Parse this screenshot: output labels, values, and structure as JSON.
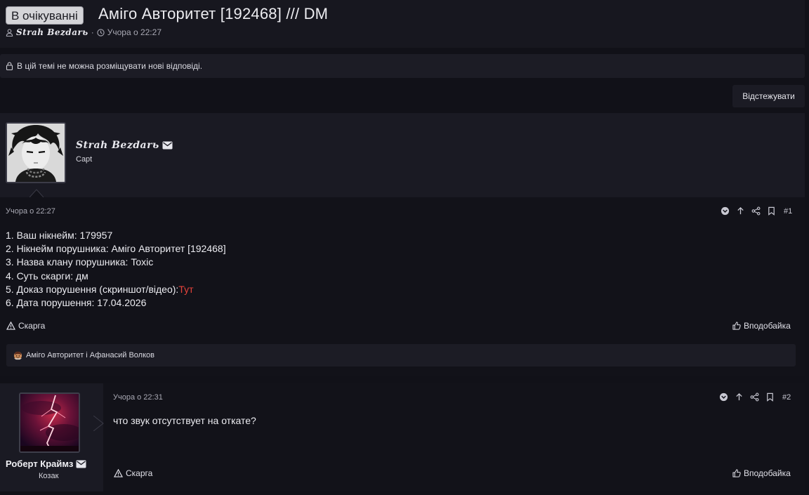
{
  "thread": {
    "prefix": "В очікуванні",
    "title": "Аміго Авторитет [192468] /// DM",
    "author": "Strah Bezdarь",
    "separator": "·",
    "date": "Учора о 22:27",
    "locked_notice": "В цій темі не можна розміщувати нові відповіді.",
    "follow_label": "Відстежувати"
  },
  "post1": {
    "username": "Strah Bezdarь",
    "role": "Capt",
    "date": "Учора о 22:27",
    "number": "#1",
    "lines": [
      "1. Ваш нікнейм: 179957",
      "2. Нікнейм порушника: Аміго Авторитет [192468]",
      "3. Назва клану порушника: Toxic",
      "4. Суть скарги: дм",
      "5. Доказ порушення (скриншот/відео):",
      "6. Дата порушення: 17.04.2026"
    ],
    "link_text": "Тут",
    "report_label": "Скарга",
    "like_label": "Вподобайка",
    "reactions_text": "Аміго Авторитет і Афанасий Волков"
  },
  "post2": {
    "username": "Роберт Краймз",
    "role": "Козак",
    "date": "Учора о 22:31",
    "number": "#2",
    "content": "что звук отсутствует на откате?",
    "report_label": "Скарга",
    "like_label": "Вподобайка"
  },
  "icons": {
    "user": "user-icon",
    "clock": "clock-icon",
    "lock": "lock-icon",
    "envelope": "envelope-icon",
    "down": "chevron-down-circle-icon",
    "up": "arrow-up-icon",
    "share": "share-icon",
    "bookmark": "bookmark-icon",
    "warning": "warning-icon",
    "thumbs_up": "thumbs-up-icon"
  },
  "colors": {
    "background": "#111118",
    "panel": "#1a1a23",
    "link_red": "#e5433b",
    "badge_bg": "#d4d4d8"
  }
}
